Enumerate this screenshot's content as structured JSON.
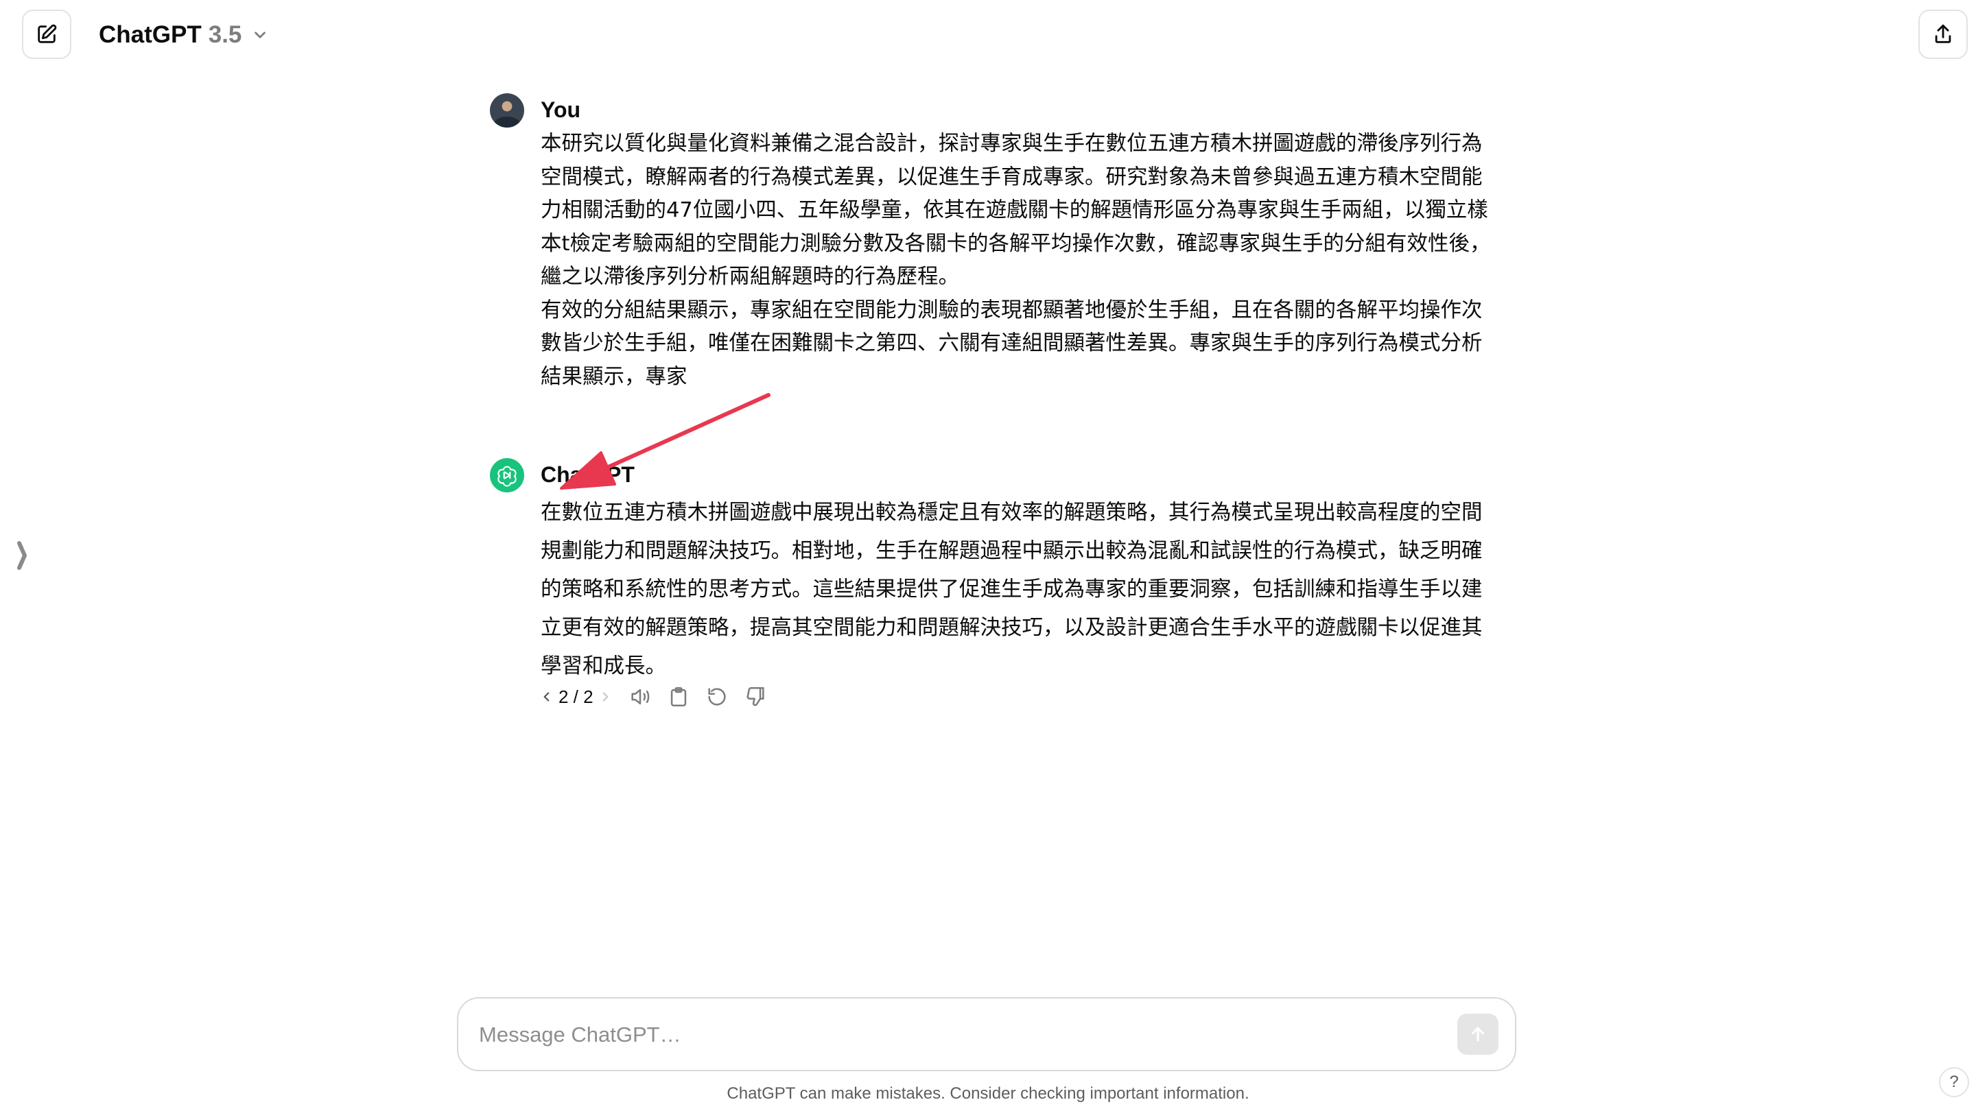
{
  "header": {
    "new_chat_icon": "compose-icon",
    "model_name": "ChatGPT",
    "model_version": "3.5",
    "share_icon": "share-icon"
  },
  "sidebar": {
    "toggle_icon": "chevron-right-icon"
  },
  "conversation": {
    "user": {
      "author": "You",
      "paragraphs": [
        "本研究以質化與量化資料兼備之混合設計，探討專家與生手在數位五連方積木拼圖遊戲的滯後序列行為空間模式，瞭解兩者的行為模式差異，以促進生手育成專家。研究對象為未曾參與過五連方積木空間能力相關活動的47位國小四、五年級學童，依其在遊戲關卡的解題情形區分為專家與生手兩組，以獨立樣本t檢定考驗兩組的空間能力測驗分數及各關卡的各解平均操作次數，確認專家與生手的分組有效性後，繼之以滯後序列分析兩組解題時的行為歷程。",
        "有效的分組結果顯示，專家組在空間能力測驗的表現都顯著地優於生手組，且在各關的各解平均操作次數皆少於生手組，唯僅在困難關卡之第四、六關有達組間顯著性差異。專家與生手的序列行為模式分析結果顯示，專家"
      ]
    },
    "assistant": {
      "author": "ChatGPT",
      "text": "在數位五連方積木拼圖遊戲中展現出較為穩定且有效率的解題策略，其行為模式呈現出較高程度的空間規劃能力和問題解決技巧。相對地，生手在解題過程中顯示出較為混亂和試誤性的行為模式，缺乏明確的策略和系統性的思考方式。這些結果提供了促進生手成為專家的重要洞察，包括訓練和指導生手以建立更有效的解題策略，提高其空間能力和問題解決技巧，以及設計更適合生手水平的遊戲關卡以促進其學習和成長。",
      "pager": "2 / 2",
      "action_icons": [
        "read-aloud-icon",
        "copy-icon",
        "regenerate-icon",
        "thumbs-down-icon"
      ]
    }
  },
  "composer": {
    "placeholder": "Message ChatGPT…",
    "value": "",
    "send_icon": "arrow-up-icon"
  },
  "footer": {
    "disclaimer": "ChatGPT can make mistakes. Consider checking important information.",
    "help_label": "?"
  },
  "annotation": {
    "color": "#e8384f"
  }
}
